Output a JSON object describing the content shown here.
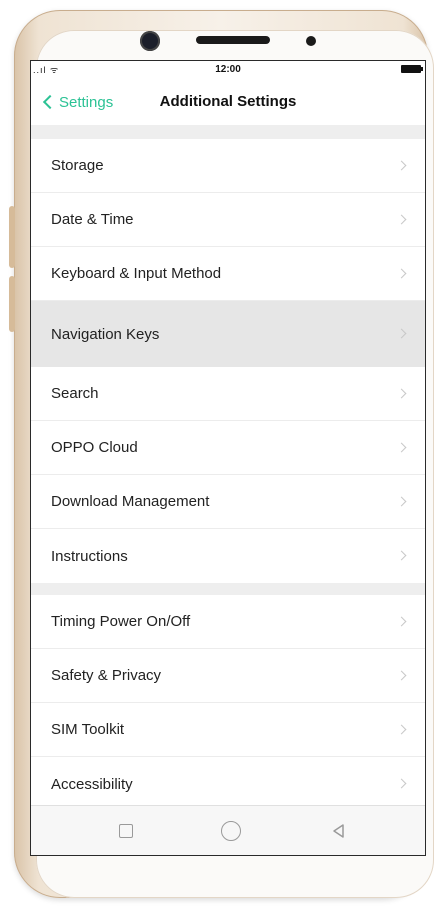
{
  "status_bar": {
    "signal": "..ıl ᯤ",
    "time": "12:00"
  },
  "header": {
    "back_label": "Settings",
    "title": "Additional Settings"
  },
  "groups": [
    {
      "items": [
        "Storage",
        "Date & Time",
        "Keyboard & Input Method",
        "Navigation Keys"
      ]
    },
    {
      "items": [
        "Search",
        "OPPO Cloud",
        "Download Management",
        "Instructions"
      ]
    },
    {
      "items": [
        "Timing Power On/Off",
        "Safety & Privacy",
        "SIM Toolkit",
        "Accessibility"
      ]
    }
  ],
  "highlighted_item": "Navigation Keys",
  "colors": {
    "accent": "#2cc295",
    "highlight_bg": "#e6e6e6",
    "group_gap": "#eeeeee"
  },
  "icons": {
    "back": "chevron-left-icon",
    "row": "chevron-right-icon",
    "nav": [
      "square-recents-icon",
      "circle-home-icon",
      "triangle-back-icon"
    ]
  }
}
